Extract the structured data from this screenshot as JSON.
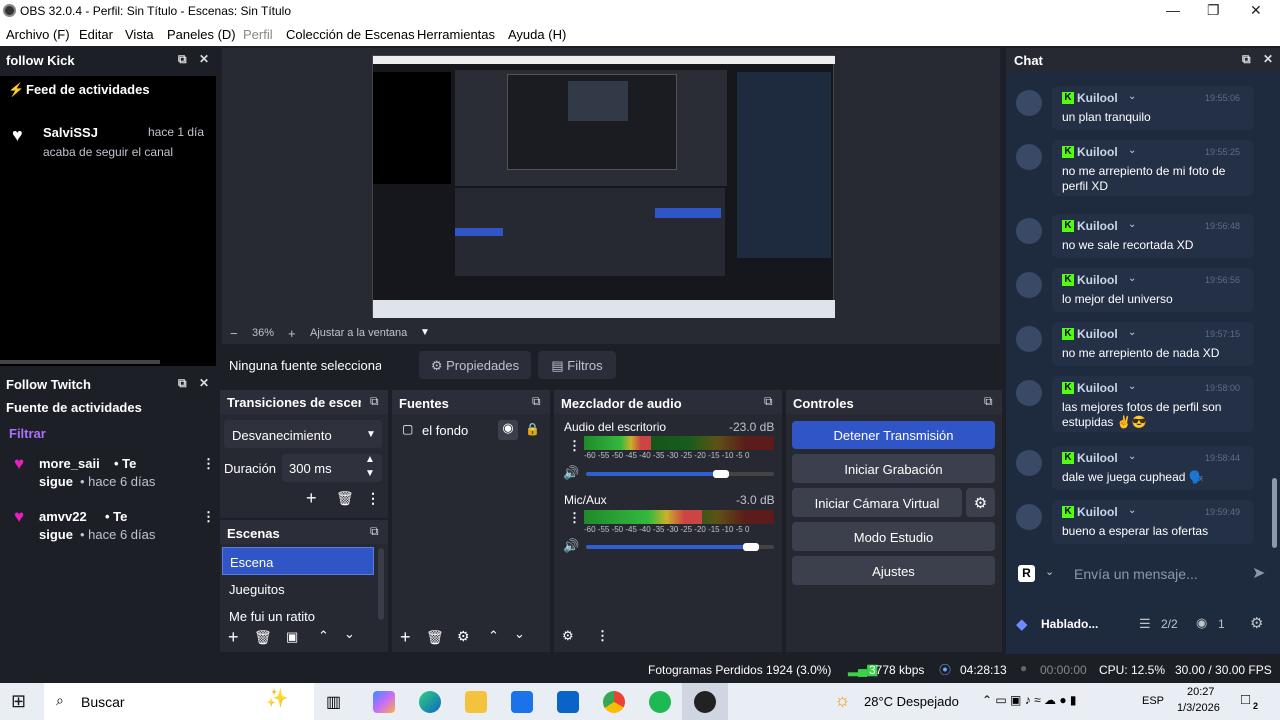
{
  "window": {
    "title": "OBS 32.0.4 - Perfil: Sin Título - Escenas: Sin Título"
  },
  "menu": [
    "Archivo (F)",
    "Editar",
    "Vista",
    "Paneles (D)",
    "Perfil",
    "Colección de Escenas",
    "Herramientas",
    "Ayuda (H)"
  ],
  "kick_dock": {
    "title": "follow Kick",
    "feed_title": "Feed de actividades",
    "user": "SalviSSJ",
    "time": "hace 1 día",
    "action": "acaba de seguir el canal"
  },
  "twitch_dock": {
    "title": "Follow Twitch",
    "feed_title": "Fuente de actividades",
    "filter": "Filtrar",
    "items": [
      {
        "user": "more_saii",
        "text1": "• Te",
        "text2": "sigue",
        "time": "• hace 6 días"
      },
      {
        "user": "amvv22",
        "text1": "• Te",
        "text2": "sigue",
        "time": "• hace 6 días"
      }
    ]
  },
  "preview": {
    "zoom": "36%",
    "fit": "Ajustar a la ventana",
    "no_source": "Ninguna fuente seleccionada",
    "properties": "Propiedades",
    "filters": "Filtros"
  },
  "transitions": {
    "title": "Transiciones de escena",
    "type": "Desvanecimiento",
    "duration_label": "Duración",
    "duration_value": "300 ms"
  },
  "scenes": {
    "title": "Escenas",
    "items": [
      "Escena",
      "Jueguitos",
      "Me fui un ratito"
    ]
  },
  "sources": {
    "title": "Fuentes",
    "items": [
      "el fondo"
    ]
  },
  "mixer": {
    "title": "Mezclador de audio",
    "ticks": "-60 -55 -50 -45 -40 -35 -30 -25 -20 -15 -10 -5 0",
    "channels": [
      {
        "name": "Audio del escritorio",
        "db": "-23.0 dB",
        "level": 0.35,
        "volume": 0.72
      },
      {
        "name": "Mic/Aux",
        "db": "-3.0 dB",
        "level": 0.62,
        "volume": 0.88
      }
    ]
  },
  "controls": {
    "title": "Controles",
    "stop_stream": "Detener Transmisión",
    "start_rec": "Iniciar Grabación",
    "virtual_cam": "Iniciar Cámara Virtual",
    "studio": "Modo Estudio",
    "settings": "Ajustes"
  },
  "chat": {
    "title": "Chat",
    "placeholder": "Envía un mensaje...",
    "footer_name": "Hablado...",
    "footer_count": "2/2",
    "footer_viewers": "1",
    "messages": [
      {
        "user": "Kuilool",
        "time": "19:55:06",
        "text": "un plan tranquilo"
      },
      {
        "user": "Kuilool",
        "time": "19:55:25",
        "text": "no me arrepiento de mi foto de perfil XD"
      },
      {
        "user": "Kuilool",
        "time": "19:56:48",
        "text": "no we sale recortada XD"
      },
      {
        "user": "Kuilool",
        "time": "19:56:56",
        "text": "lo mejor del universo"
      },
      {
        "user": "Kuilool",
        "time": "19:57:15",
        "text": "no me arrepiento de nada XD"
      },
      {
        "user": "Kuilool",
        "time": "19:58:00",
        "text": "las mejores fotos de perfil son estupidas ✌😎"
      },
      {
        "user": "Kuilool",
        "time": "19:58:44",
        "text": "dale we juega cuphead 🗣️"
      },
      {
        "user": "Kuilool",
        "time": "19:59:49",
        "text": "bueno a esperar las ofertas"
      }
    ]
  },
  "status": {
    "dropped": "Fotogramas Perdidos 1924 (3.0%)",
    "bitrate": "3778 kbps",
    "live_time": "04:28:13",
    "rec_time": "00:00:00",
    "cpu": "CPU: 12.5%",
    "fps": "30.00 / 30.00 FPS"
  },
  "taskbar": {
    "search": "Buscar",
    "weather": "28°C  Despejado",
    "lang": "ESP",
    "time": "20:27",
    "date": "1/3/2026",
    "notif": "2"
  }
}
